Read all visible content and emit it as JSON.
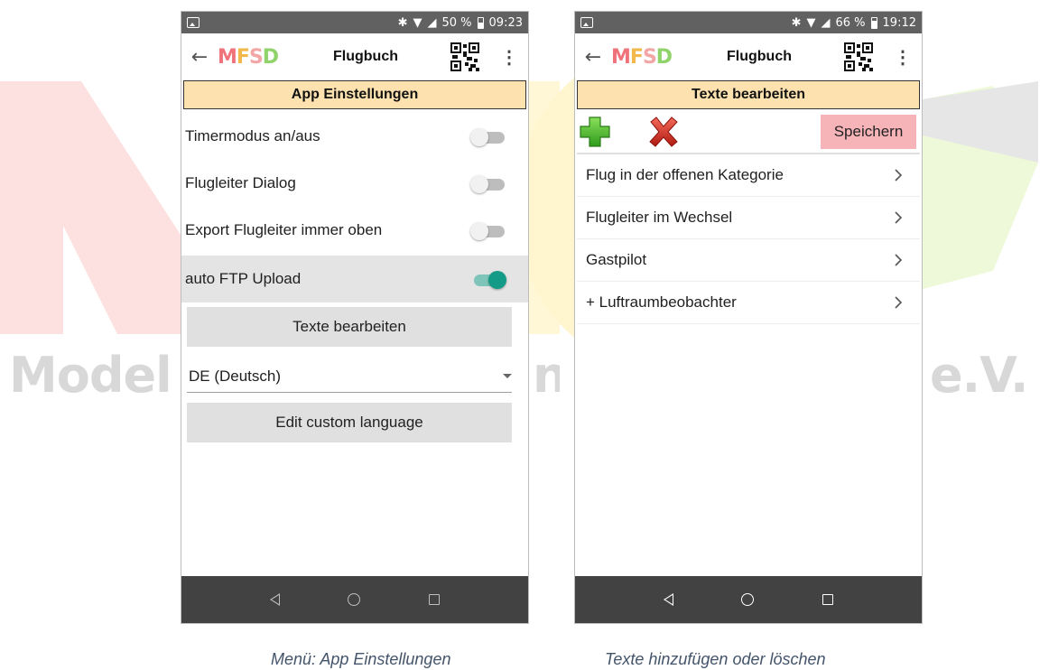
{
  "watermark": {
    "left_text": "Model",
    "right_text": "e.V."
  },
  "left_phone": {
    "status": {
      "battery": "50 %",
      "time": "09:23"
    },
    "toolbar": {
      "title": "Flugbuch",
      "logo": "MFSD"
    },
    "section_header": "App Einstellungen",
    "settings": [
      {
        "label": "Timermodus an/aus",
        "enabled": false
      },
      {
        "label": "Flugleiter Dialog",
        "enabled": false
      },
      {
        "label": "Export Flugleiter immer oben",
        "enabled": false
      },
      {
        "label": "auto FTP Upload",
        "enabled": true
      }
    ],
    "edit_texts_button": "Texte bearbeiten",
    "language_select": "DE (Deutsch)",
    "edit_language_button": "Edit custom language"
  },
  "right_phone": {
    "status": {
      "battery": "66 %",
      "time": "19:12"
    },
    "toolbar": {
      "title": "Flugbuch",
      "logo": "MFSD"
    },
    "section_header": "Texte bearbeiten",
    "save_button": "Speichern",
    "items": [
      "Flug in der offenen Kategorie",
      "Flugleiter im Wechsel",
      "Gastpilot",
      "+ Luftraumbeobachter"
    ]
  },
  "captions": {
    "left": "Menü: App Einstellungen",
    "right": "Texte hinzufügen oder löschen"
  },
  "colors": {
    "header_bg": "#fde2b0",
    "toggle_on": "#149b87",
    "save_bg": "#f6b4b8",
    "navbar": "#424242",
    "statusbar": "#616161"
  }
}
